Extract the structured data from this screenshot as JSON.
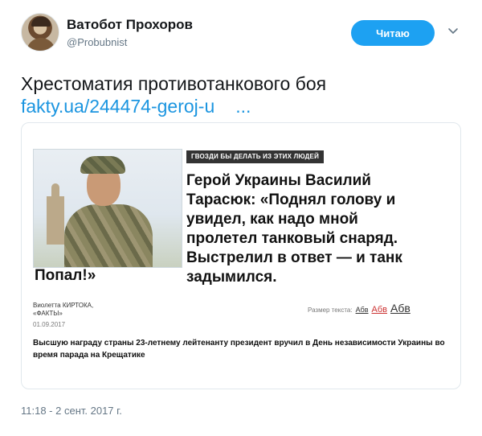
{
  "author": {
    "name": "Ватобот Прохоров",
    "handle": "@Probubnist"
  },
  "actions": {
    "follow_label": "Читаю",
    "menu_icon": "chevron-down-icon"
  },
  "tweet": {
    "text": "Хрестоматия противотанкового боя",
    "link": "fakty.ua/244474-geroj-u",
    "link_ellipsis": "...",
    "timestamp": "11:18 - 2 сент. 2017 г."
  },
  "card": {
    "tag": "ГВОЗДИ БЫ ДЕЛАТЬ ИЗ ЭТИХ ЛЮДЕЙ",
    "headline": "Герой Украины Василий Тарасюк: «Поднял голову и увидел, как надо мной пролетел танковый снаряд. Выстрелил в ответ — и танк задымился.",
    "headline_tail": "Попал!»",
    "author_line1": "Виолетта КИРТОКА,",
    "author_line2": "«ФАКТЫ»",
    "date": "01.09.2017",
    "text_size_label": "Размер текста:",
    "size_small": "Абв",
    "size_medium": "Абв",
    "size_large": "Абв",
    "lead": "Высшую награду страны 23-летнему лейтенанту президент вручил в День независимости Украины во время парада на Крещатике"
  },
  "colors": {
    "accent": "#1da1f2",
    "link": "#1b95e0",
    "muted": "#657786"
  }
}
